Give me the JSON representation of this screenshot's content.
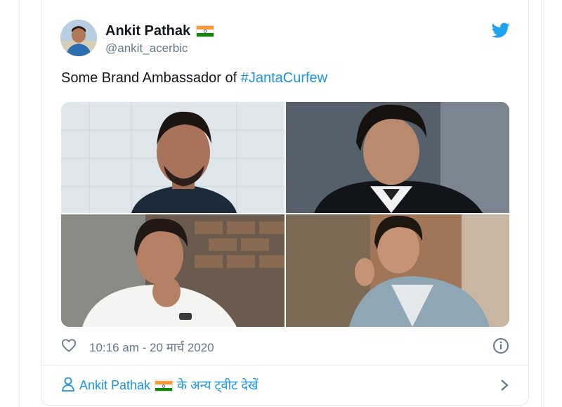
{
  "tweet": {
    "author_name": "Ankit Pathak",
    "author_handle": "@ankit_acerbic",
    "text_prefix": "Some Brand Ambassador of ",
    "hashtag": "#JantaCurfew",
    "timestamp": "10:16 am - 20 मार्च 2020",
    "icons": [
      "india-flag-icon",
      "twitter-bird-icon",
      "heart-icon",
      "info-icon",
      "person-icon",
      "chevron-right-icon"
    ]
  },
  "footer": {
    "author_name": "Ankit Pathak",
    "more_tweets_label": "के अन्य ट्वीट देखें"
  },
  "colors": {
    "accent": "#1b95e0",
    "text": "#14171a",
    "muted": "#657786",
    "border": "#e1e8ed"
  }
}
